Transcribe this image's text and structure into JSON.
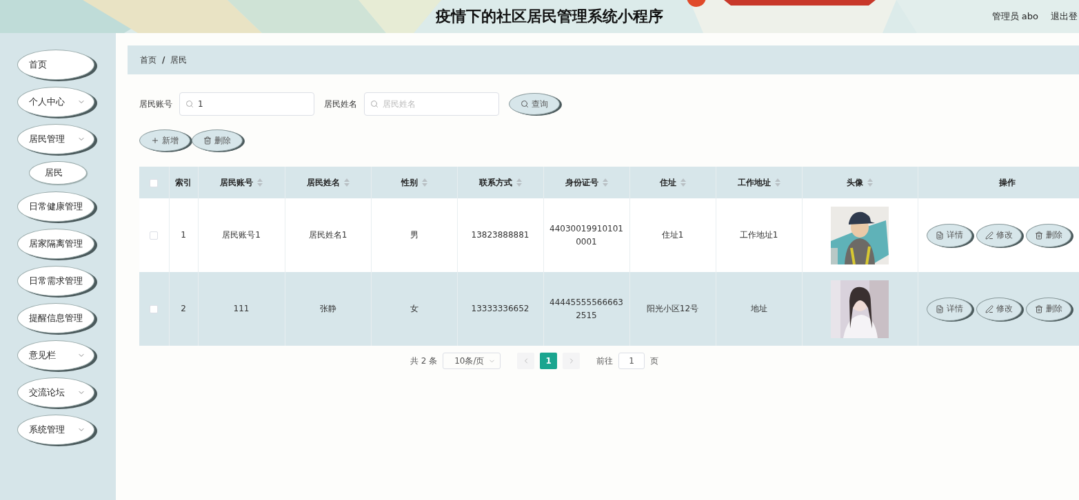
{
  "header": {
    "title": "疫情下的社区居民管理系统小程序",
    "user": "管理员 abo",
    "logout": "退出登"
  },
  "sidebar": {
    "items": [
      {
        "label": "首页",
        "expandable": false
      },
      {
        "label": "个人中心",
        "expandable": true
      },
      {
        "label": "居民管理",
        "expandable": true,
        "children": [
          {
            "label": "居民"
          }
        ]
      },
      {
        "label": "日常健康管理",
        "expandable": false
      },
      {
        "label": "居家隔离管理",
        "expandable": false
      },
      {
        "label": "日常需求管理",
        "expandable": false
      },
      {
        "label": "提醒信息管理",
        "expandable": false
      },
      {
        "label": "意见栏",
        "expandable": true
      },
      {
        "label": "交流论坛",
        "expandable": true
      },
      {
        "label": "系统管理",
        "expandable": true
      }
    ]
  },
  "breadcrumb": {
    "items": [
      "首页",
      "居民"
    ],
    "separator": "/"
  },
  "search": {
    "fields": [
      {
        "label": "居民账号",
        "value": "1"
      },
      {
        "label": "居民姓名",
        "placeholder": "居民姓名"
      }
    ],
    "button": "查询"
  },
  "actions": [
    {
      "label": "新增",
      "kind": "add"
    },
    {
      "label": "删除",
      "kind": "delete"
    }
  ],
  "table": {
    "header_checked": false,
    "columns": [
      {
        "label": "索引",
        "sortable": false
      },
      {
        "label": "居民账号",
        "sortable": true
      },
      {
        "label": "居民姓名",
        "sortable": true
      },
      {
        "label": "性别",
        "sortable": true
      },
      {
        "label": "联系方式",
        "sortable": true
      },
      {
        "label": "身份证号",
        "sortable": true
      },
      {
        "label": "住址",
        "sortable": true
      },
      {
        "label": "工作地址",
        "sortable": true
      },
      {
        "label": "头像",
        "sortable": true
      },
      {
        "label": "操作",
        "sortable": false
      }
    ],
    "rows": [
      {
        "checked": false,
        "highlighted": false,
        "cells": [
          "1",
          "居民账号1",
          "居民姓名1",
          "男",
          "13823888881",
          "440300199101010001",
          "住址1",
          "工作地址1"
        ],
        "actions": [
          {
            "label": "详情",
            "kind": "detail"
          },
          {
            "label": "修改",
            "kind": "edit"
          },
          {
            "label": "删除",
            "kind": "delete"
          }
        ]
      },
      {
        "checked": false,
        "highlighted": true,
        "cells": [
          "2",
          "111",
          "张静",
          "女",
          "13333336652",
          "444455555666632515",
          "阳光小区12号",
          "地址"
        ],
        "actions": [
          {
            "label": "详情",
            "kind": "detail"
          },
          {
            "label": "修改",
            "kind": "edit"
          },
          {
            "label": "删除",
            "kind": "delete"
          }
        ]
      }
    ]
  },
  "pagination": {
    "total": "共 2 条",
    "page_size": "10条/页",
    "pages": [
      {
        "label": "1",
        "selected": true
      }
    ],
    "goto_label": "前往",
    "goto_value": "1",
    "goto_suffix": "页"
  }
}
